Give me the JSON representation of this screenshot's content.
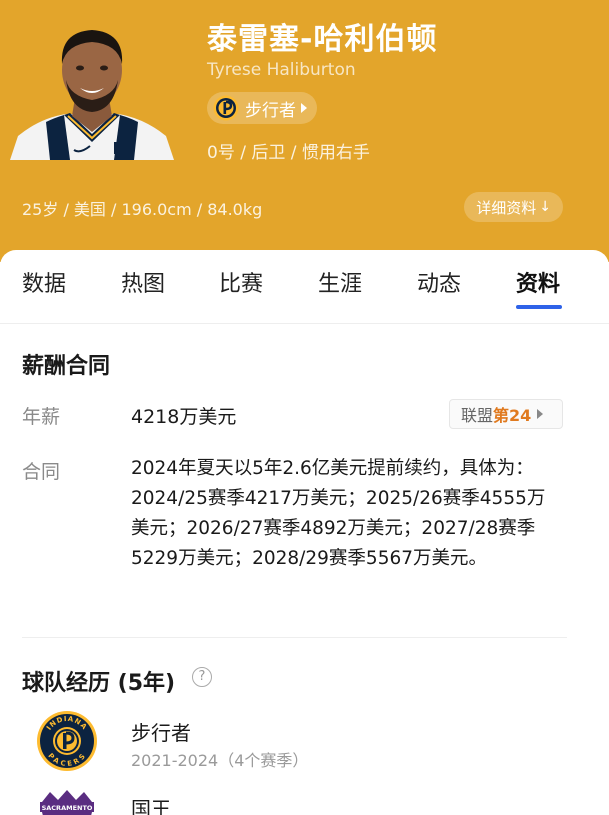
{
  "player": {
    "name_cn": "泰雷塞-哈利伯顿",
    "name_en": "Tyrese Haliburton",
    "team": "步行者",
    "number_position": "0号 / 后卫 / 惯用右手",
    "bio": "25岁 / 美国 / 196.0cm / 84.0kg",
    "detail_button": "详细资料",
    "detail_arrow": "↓"
  },
  "tabs": [
    "数据",
    "热图",
    "比赛",
    "生涯",
    "动态",
    "资料"
  ],
  "active_tab": "资料",
  "salary": {
    "title": "薪酬合同",
    "annual_label": "年薪",
    "annual_value": "4218万美元",
    "rank_prefix": "联盟",
    "rank_value": "第24",
    "contract_label": "合同",
    "contract_text": "2024年夏天以5年2.6亿美元提前续约，具体为：2024/25赛季4217万美元；2025/26赛季4555万美元；2026/27赛季4892万美元；2027/28赛季5229万美元；2028/29赛季5567万美元。"
  },
  "history": {
    "title": "球队经历 (5年)",
    "help_icon": "?",
    "teams": [
      {
        "name": "步行者",
        "years": "2021-2024（4个赛季）",
        "logo_text_top": "INDIANA",
        "logo_text_bottom": "PACERS"
      },
      {
        "name": "国王",
        "years": "",
        "logo_text_top": "SACRAMENTO"
      }
    ]
  },
  "colors": {
    "header_bg": "#e3a52b",
    "accent_blue": "#2e62e8",
    "rank_orange": "#e07a1f",
    "pacers_navy": "#0c2340",
    "pacers_gold": "#fdbb30",
    "kings_purple": "#5a2d81"
  },
  "icons": [
    "pacers-logo-icon",
    "chevron-right-icon",
    "arrow-down-icon",
    "help-circle-icon",
    "kings-logo-icon"
  ]
}
